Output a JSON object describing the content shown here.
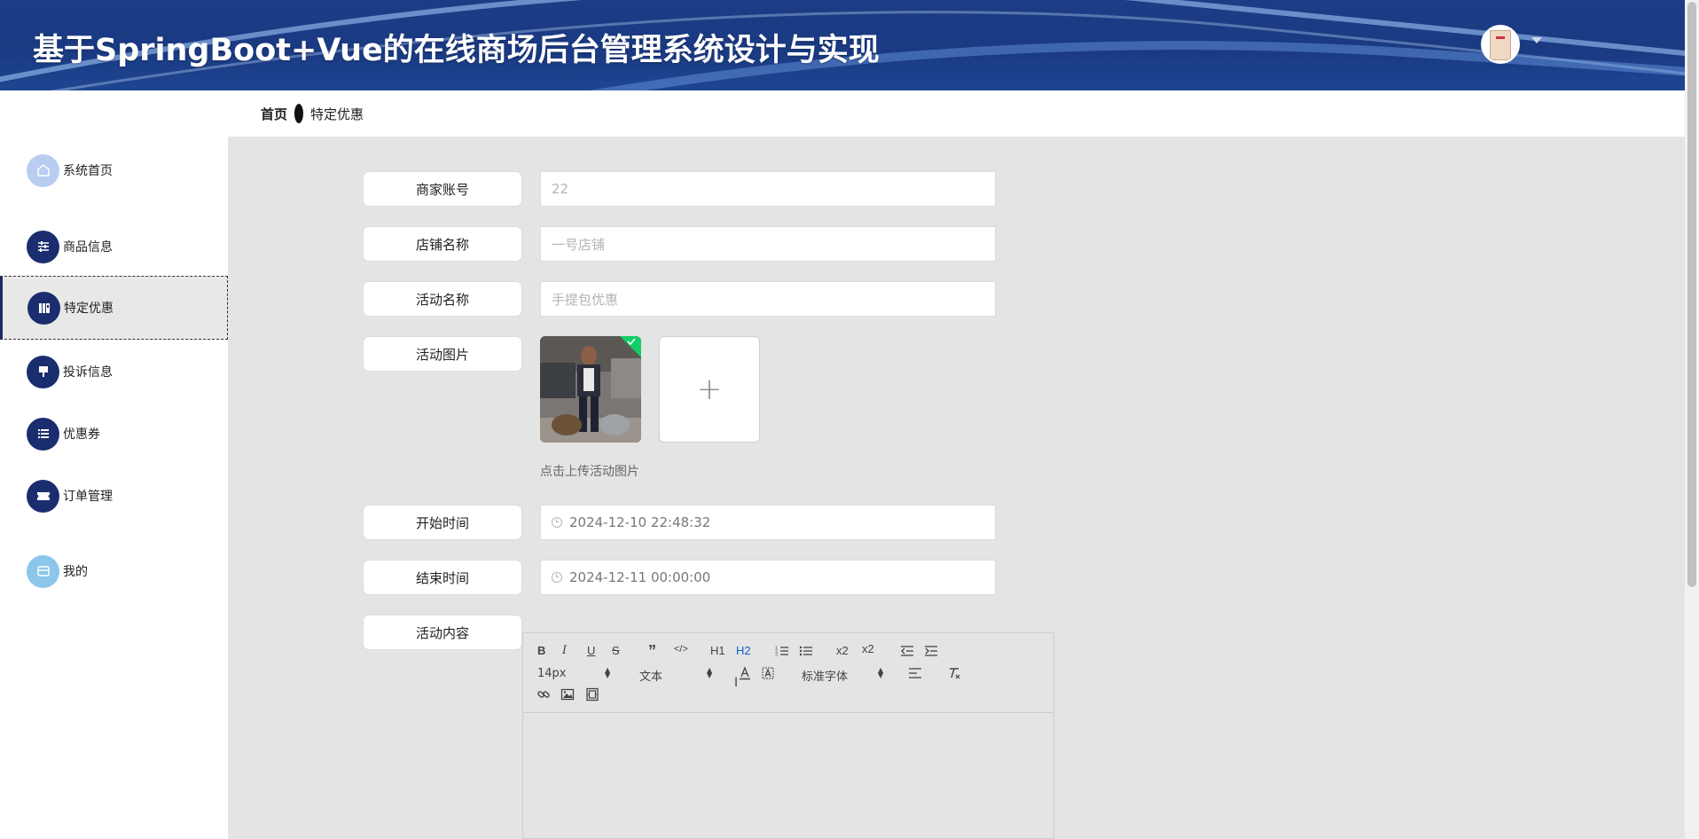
{
  "header": {
    "title": "基于SpringBoot+Vue的在线商场后台管理系统设计与实现"
  },
  "breadcrumb": {
    "home": "首页",
    "current": "特定优惠"
  },
  "sidebar": {
    "items": [
      {
        "label": "系统首页",
        "icon": "home-icon"
      },
      {
        "label": "商品信息",
        "icon": "sliders-icon"
      },
      {
        "label": "特定优惠",
        "icon": "book-icon",
        "active": true
      },
      {
        "label": "投诉信息",
        "icon": "brush-icon"
      },
      {
        "label": "优惠券",
        "icon": "list-icon"
      },
      {
        "label": "订单管理",
        "icon": "ticket-icon"
      },
      {
        "label": "我的",
        "icon": "wallet-icon"
      }
    ]
  },
  "form": {
    "merchant_account": {
      "label": "商家账号",
      "value": "22"
    },
    "shop_name": {
      "label": "店铺名称",
      "value": "一号店铺"
    },
    "activity_name": {
      "label": "活动名称",
      "value": "手提包优惠"
    },
    "activity_image": {
      "label": "活动图片",
      "add": "+",
      "tip": "点击上传活动图片"
    },
    "start_time": {
      "label": "开始时间",
      "value": "2024-12-10 22:48:32"
    },
    "end_time": {
      "label": "结束时间",
      "value": "2024-12-11 00:00:00"
    },
    "content": {
      "label": "活动内容"
    }
  },
  "editor": {
    "bold": "B",
    "italic": "I",
    "underline": "U",
    "strike": "S",
    "quote": "”",
    "code": "</>",
    "h1": "H1",
    "h2": "H2",
    "sub": "x2",
    "sup": "x2",
    "size_select": "14px",
    "header_select": "文本",
    "font_select": "标准字体"
  },
  "colors": {
    "header_bg": "#1a3a82",
    "accent": "#1a2d6e",
    "content_bg": "#e4e4e4"
  }
}
